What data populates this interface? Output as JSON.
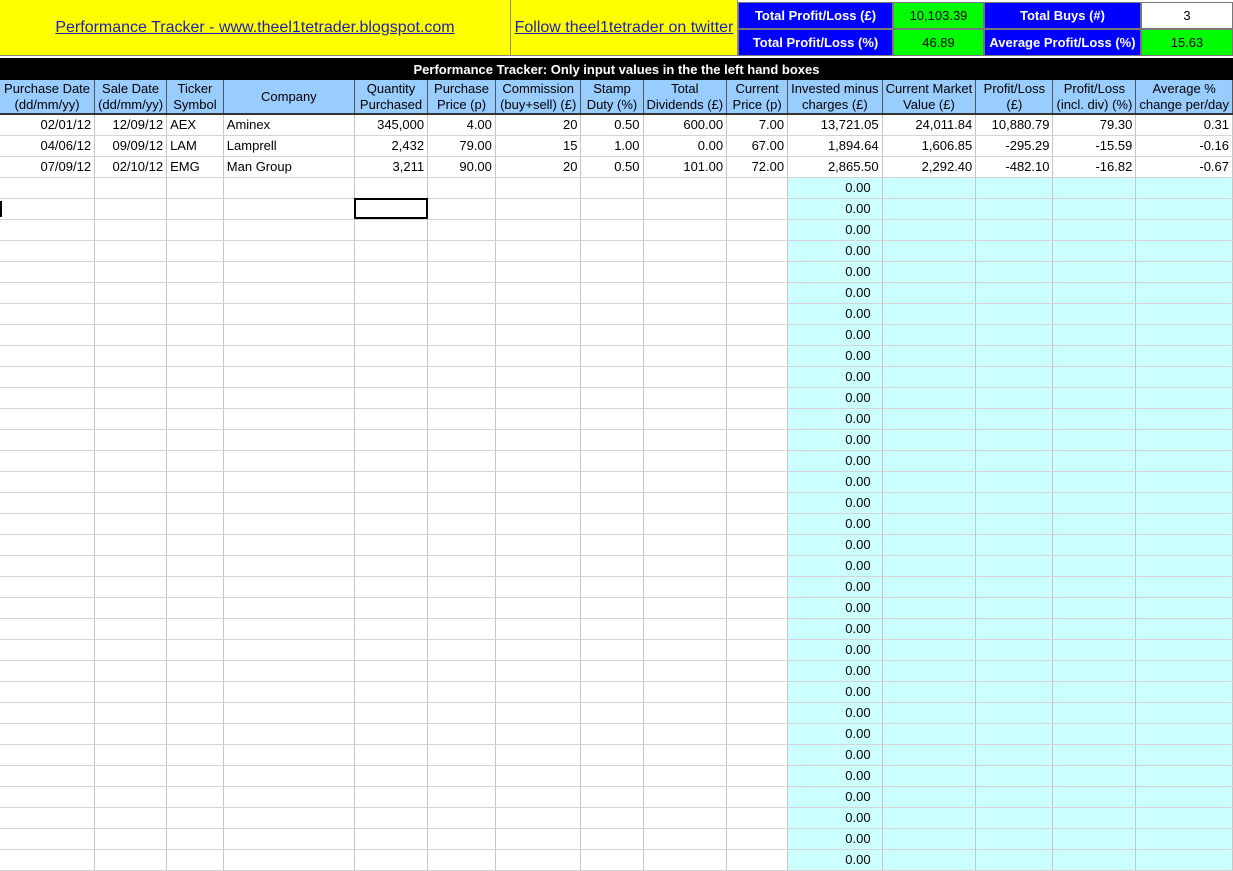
{
  "banner": {
    "link_text": "Performance Tracker - www.theel1tetrader.blogspot.com",
    "twitter_text": "Follow theel1tetrader on twitter"
  },
  "stats": {
    "total_pl_label": "Total Profit/Loss (£)",
    "total_pl_value": "10,103.39",
    "total_buys_label": "Total Buys (#)",
    "total_buys_value": "3",
    "total_pl_pct_label": "Total Profit/Loss (%)",
    "total_pl_pct_value": "46.89",
    "avg_pl_pct_label": "Average Profit/Loss (%)",
    "avg_pl_pct_value": "15.63"
  },
  "title_bar": "Performance Tracker: Only input values in the the left hand boxes",
  "columns": [
    {
      "key": "purchase_date",
      "l1": "Purchase Date",
      "l2": "(dd/mm/yy)"
    },
    {
      "key": "sale_date",
      "l1": "Sale Date",
      "l2": "(dd/mm/yy)"
    },
    {
      "key": "ticker",
      "l1": "Ticker",
      "l2": "Symbol"
    },
    {
      "key": "company",
      "l1": "Company",
      "l2": ""
    },
    {
      "key": "quantity",
      "l1": "Quantity",
      "l2": "Purchased"
    },
    {
      "key": "purchase_price",
      "l1": "Purchase",
      "l2": "Price (p)"
    },
    {
      "key": "commission",
      "l1": "Commission",
      "l2": "(buy+sell) (£)"
    },
    {
      "key": "stamp_duty",
      "l1": "Stamp",
      "l2": "Duty (%)"
    },
    {
      "key": "dividends",
      "l1": "Total",
      "l2": "Dividends (£)"
    },
    {
      "key": "current_price",
      "l1": "Current",
      "l2": "Price (p)"
    },
    {
      "key": "invested",
      "l1": "Invested minus",
      "l2": "charges (£)"
    },
    {
      "key": "market_value",
      "l1": "Current Market",
      "l2": "Value (£)"
    },
    {
      "key": "profit_loss",
      "l1": "Profit/Loss",
      "l2": "(£)"
    },
    {
      "key": "profit_loss_pct",
      "l1": "Profit/Loss",
      "l2": "(incl. div) (%)"
    },
    {
      "key": "avg_change",
      "l1": "Average %",
      "l2": "change per/day"
    }
  ],
  "rows": [
    [
      "02/01/12",
      "12/09/12",
      "AEX",
      "Aminex",
      "345,000",
      "4.00",
      "20",
      "0.50",
      "600.00",
      "7.00",
      "13,721.05",
      "24,011.84",
      "10,880.79",
      "79.30",
      "0.31"
    ],
    [
      "04/06/12",
      "09/09/12",
      "LAM",
      "Lamprell",
      "2,432",
      "79.00",
      "15",
      "1.00",
      "0.00",
      "67.00",
      "1,894.64",
      "1,606.85",
      "-295.29",
      "-15.59",
      "-0.16"
    ],
    [
      "07/09/12",
      "02/10/12",
      "EMG",
      "Man Group",
      "3,211",
      "90.00",
      "20",
      "0.50",
      "101.00",
      "72.00",
      "2,865.50",
      "2,292.40",
      "-482.10",
      "-16.82",
      "-0.67"
    ]
  ],
  "empty_invested_value": "0.00",
  "empty_row_count": 33
}
